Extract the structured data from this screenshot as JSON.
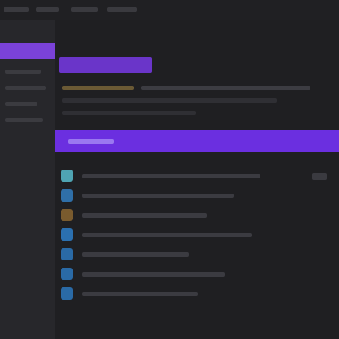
{
  "window": {
    "title": ""
  },
  "sidebar": {
    "items": [
      {
        "label": ""
      },
      {
        "label": ""
      },
      {
        "label": ""
      },
      {
        "label": ""
      },
      {
        "label": ""
      }
    ]
  },
  "main": {
    "heading": "",
    "selected_row": "",
    "list": [
      {
        "label": "",
        "icon": "teal-app-icon"
      },
      {
        "label": "",
        "icon": "blue-app-icon"
      },
      {
        "label": "",
        "icon": "amber-app-icon"
      },
      {
        "label": "",
        "icon": "blue-app-icon"
      },
      {
        "label": "",
        "icon": "blue-app-icon"
      },
      {
        "label": "",
        "icon": "blue-app-icon"
      },
      {
        "label": "",
        "icon": "blue-app-icon"
      }
    ]
  },
  "colors": {
    "accent": "#6b2fe0",
    "background": "#1f1f22",
    "sidebar": "#27272b"
  }
}
